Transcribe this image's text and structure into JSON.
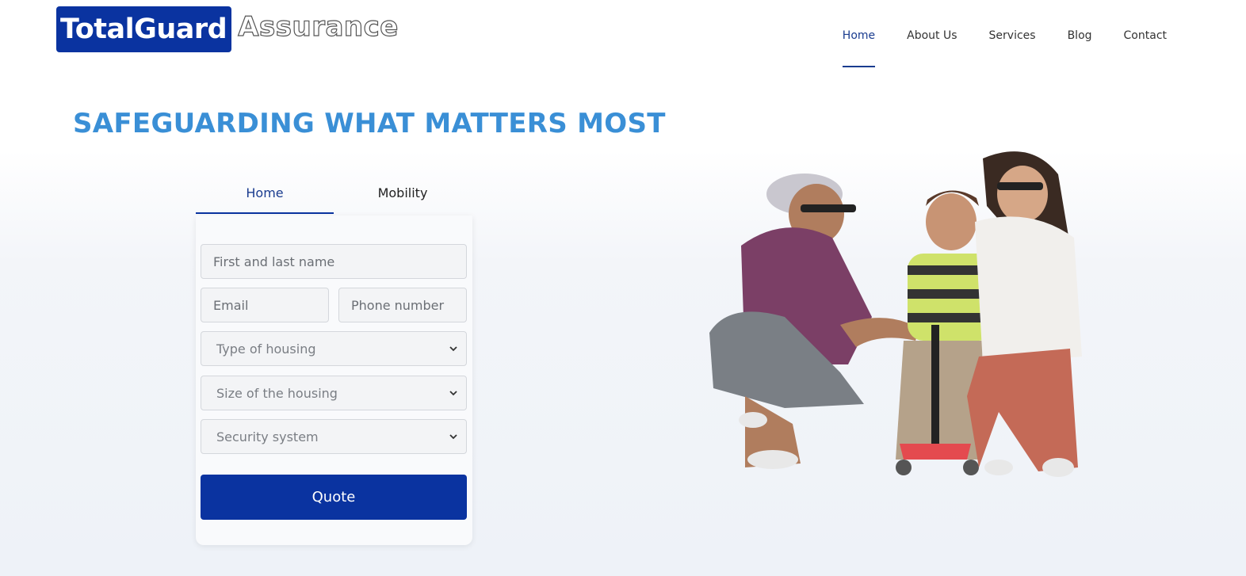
{
  "brand": {
    "name_bold": "TotalGuard",
    "name_outline": "Assurance"
  },
  "nav": [
    {
      "label": "Home",
      "active": true
    },
    {
      "label": "About Us",
      "active": false
    },
    {
      "label": "Services",
      "active": false
    },
    {
      "label": "Blog",
      "active": false
    },
    {
      "label": "Contact",
      "active": false
    }
  ],
  "hero": {
    "title": "SAFEGUARDING WHAT MATTERS MOST"
  },
  "form": {
    "tabs": [
      {
        "label": "Home",
        "active": true
      },
      {
        "label": "Mobility",
        "active": false
      }
    ],
    "name_placeholder": "First and last name",
    "email_placeholder": "Email",
    "phone_placeholder": "Phone number",
    "housing_type": "Type of housing",
    "housing_size": "Size of the housing",
    "security_system": "Security system",
    "submit_label": "Quote"
  },
  "colors": {
    "brand_blue": "#0a33a0",
    "title_blue": "#3a8fd6",
    "nav_active": "#1a3c8f"
  },
  "image": {
    "icon": "family-photo"
  }
}
